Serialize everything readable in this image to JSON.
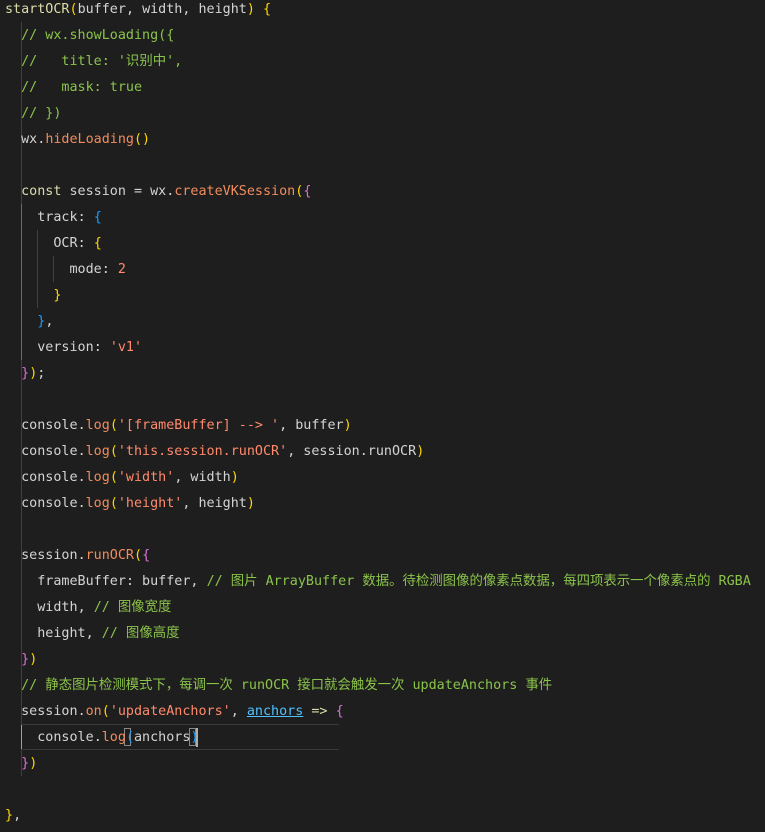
{
  "colors": {
    "background": "#1e1e1e",
    "function": "#dcdcaa",
    "string": "#ff8a6c",
    "comment": "#8bc34a",
    "bracket_1": "#ffd700",
    "bracket_2": "#da70d6",
    "bracket_3": "#179fff",
    "link": "#4fc1ff"
  },
  "lines": [
    [
      [
        "startOCR",
        "fn"
      ],
      [
        "(",
        "b1"
      ],
      [
        "buffer",
        "var"
      ],
      [
        ", ",
        "pc"
      ],
      [
        "width",
        "var"
      ],
      [
        ", ",
        "pc"
      ],
      [
        "height",
        "var"
      ],
      [
        ")",
        "b1"
      ],
      [
        " ",
        "pc"
      ],
      [
        "{",
        "b1"
      ]
    ],
    [
      [
        "  ",
        "pc"
      ],
      [
        "// wx.showLoading({",
        "cm"
      ]
    ],
    [
      [
        "  ",
        "pc"
      ],
      [
        "//   title: '识别中',",
        "cm"
      ]
    ],
    [
      [
        "  ",
        "pc"
      ],
      [
        "//   mask: true",
        "cm"
      ]
    ],
    [
      [
        "  ",
        "pc"
      ],
      [
        "// })",
        "cm"
      ]
    ],
    [
      [
        "  ",
        "pc"
      ],
      [
        "wx",
        "var"
      ],
      [
        ".",
        "pc"
      ],
      [
        "hideLoading",
        "fnr"
      ],
      [
        "()",
        "b1"
      ]
    ],
    [],
    [
      [
        "  ",
        "pc"
      ],
      [
        "const",
        "kw"
      ],
      [
        " session = ",
        "pc"
      ],
      [
        "wx",
        "var"
      ],
      [
        ".",
        "pc"
      ],
      [
        "createVKSession",
        "fnr"
      ],
      [
        "(",
        "b1"
      ],
      [
        "{",
        "b2"
      ]
    ],
    [
      [
        "    ",
        "pc"
      ],
      [
        "track",
        "prop"
      ],
      [
        ": ",
        "pc"
      ],
      [
        "{",
        "b3"
      ]
    ],
    [
      [
        "      ",
        "pc"
      ],
      [
        "OCR",
        "prop"
      ],
      [
        ": ",
        "pc"
      ],
      [
        "{",
        "b1"
      ]
    ],
    [
      [
        "        ",
        "pc"
      ],
      [
        "mode",
        "prop"
      ],
      [
        ": ",
        "pc"
      ],
      [
        "2",
        "num"
      ]
    ],
    [
      [
        "      ",
        "pc"
      ],
      [
        "}",
        "b1"
      ]
    ],
    [
      [
        "    ",
        "pc"
      ],
      [
        "}",
        "b3"
      ],
      [
        ",",
        "pc"
      ]
    ],
    [
      [
        "    ",
        "pc"
      ],
      [
        "version",
        "prop"
      ],
      [
        ": ",
        "pc"
      ],
      [
        "'v1'",
        "str"
      ]
    ],
    [
      [
        "  ",
        "pc"
      ],
      [
        "}",
        "b2"
      ],
      [
        ")",
        "b1"
      ],
      [
        ";",
        "pc"
      ]
    ],
    [],
    [
      [
        "  ",
        "pc"
      ],
      [
        "console",
        "var"
      ],
      [
        ".",
        "pc"
      ],
      [
        "log",
        "fnr"
      ],
      [
        "(",
        "b1"
      ],
      [
        "'[frameBuffer] --> '",
        "str"
      ],
      [
        ", buffer",
        "pc"
      ],
      [
        ")",
        "b1"
      ]
    ],
    [
      [
        "  ",
        "pc"
      ],
      [
        "console",
        "var"
      ],
      [
        ".",
        "pc"
      ],
      [
        "log",
        "fnr"
      ],
      [
        "(",
        "b1"
      ],
      [
        "'this.session.runOCR'",
        "str"
      ],
      [
        ", session.runOCR",
        "pc"
      ],
      [
        ")",
        "b1"
      ]
    ],
    [
      [
        "  ",
        "pc"
      ],
      [
        "console",
        "var"
      ],
      [
        ".",
        "pc"
      ],
      [
        "log",
        "fnr"
      ],
      [
        "(",
        "b1"
      ],
      [
        "'width'",
        "str"
      ],
      [
        ", width",
        "pc"
      ],
      [
        ")",
        "b1"
      ]
    ],
    [
      [
        "  ",
        "pc"
      ],
      [
        "console",
        "var"
      ],
      [
        ".",
        "pc"
      ],
      [
        "log",
        "fnr"
      ],
      [
        "(",
        "b1"
      ],
      [
        "'height'",
        "str"
      ],
      [
        ", height",
        "pc"
      ],
      [
        ")",
        "b1"
      ]
    ],
    [],
    [
      [
        "  ",
        "pc"
      ],
      [
        "session",
        "var"
      ],
      [
        ".",
        "pc"
      ],
      [
        "runOCR",
        "fnr"
      ],
      [
        "(",
        "b1"
      ],
      [
        "{",
        "b2"
      ]
    ],
    [
      [
        "    ",
        "pc"
      ],
      [
        "frameBuffer",
        "prop"
      ],
      [
        ": buffer, ",
        "pc"
      ],
      [
        "// 图片 ArrayBuffer 数据。待检测图像的像素点数据，每四项表示一个像素点的 RGBA",
        "cm"
      ]
    ],
    [
      [
        "    ",
        "pc"
      ],
      [
        "width",
        "prop"
      ],
      [
        ", ",
        "pc"
      ],
      [
        "// 图像宽度",
        "cm"
      ]
    ],
    [
      [
        "    ",
        "pc"
      ],
      [
        "height",
        "prop"
      ],
      [
        ", ",
        "pc"
      ],
      [
        "// 图像高度",
        "cm"
      ]
    ],
    [
      [
        "  ",
        "pc"
      ],
      [
        "}",
        "b2"
      ],
      [
        ")",
        "b1"
      ]
    ],
    [
      [
        "  ",
        "pc"
      ],
      [
        "// 静态图片检测模式下，每调一次 runOCR 接口就会触发一次 updateAnchors 事件",
        "cm"
      ]
    ],
    [
      [
        "  ",
        "pc"
      ],
      [
        "session",
        "var"
      ],
      [
        ".",
        "pc"
      ],
      [
        "on",
        "fnr"
      ],
      [
        "(",
        "b1"
      ],
      [
        "'updateAnchors'",
        "str"
      ],
      [
        ", ",
        "pc"
      ],
      [
        "anchors",
        "link"
      ],
      [
        " ",
        "pc"
      ],
      [
        "=>",
        "kw"
      ],
      [
        " ",
        "pc"
      ],
      [
        "{",
        "b2"
      ]
    ],
    [
      [
        "    ",
        "pc"
      ],
      [
        "console",
        "var"
      ],
      [
        ".",
        "pc"
      ],
      [
        "log",
        "fnr"
      ],
      [
        "(",
        "b3"
      ],
      [
        "anchors",
        "var"
      ],
      [
        ")",
        "b3"
      ]
    ],
    [
      [
        "  ",
        "pc"
      ],
      [
        "}",
        "b2"
      ],
      [
        ")",
        "b1"
      ]
    ],
    [],
    [
      [
        "}",
        "b1"
      ],
      [
        ",",
        "pc"
      ]
    ]
  ]
}
